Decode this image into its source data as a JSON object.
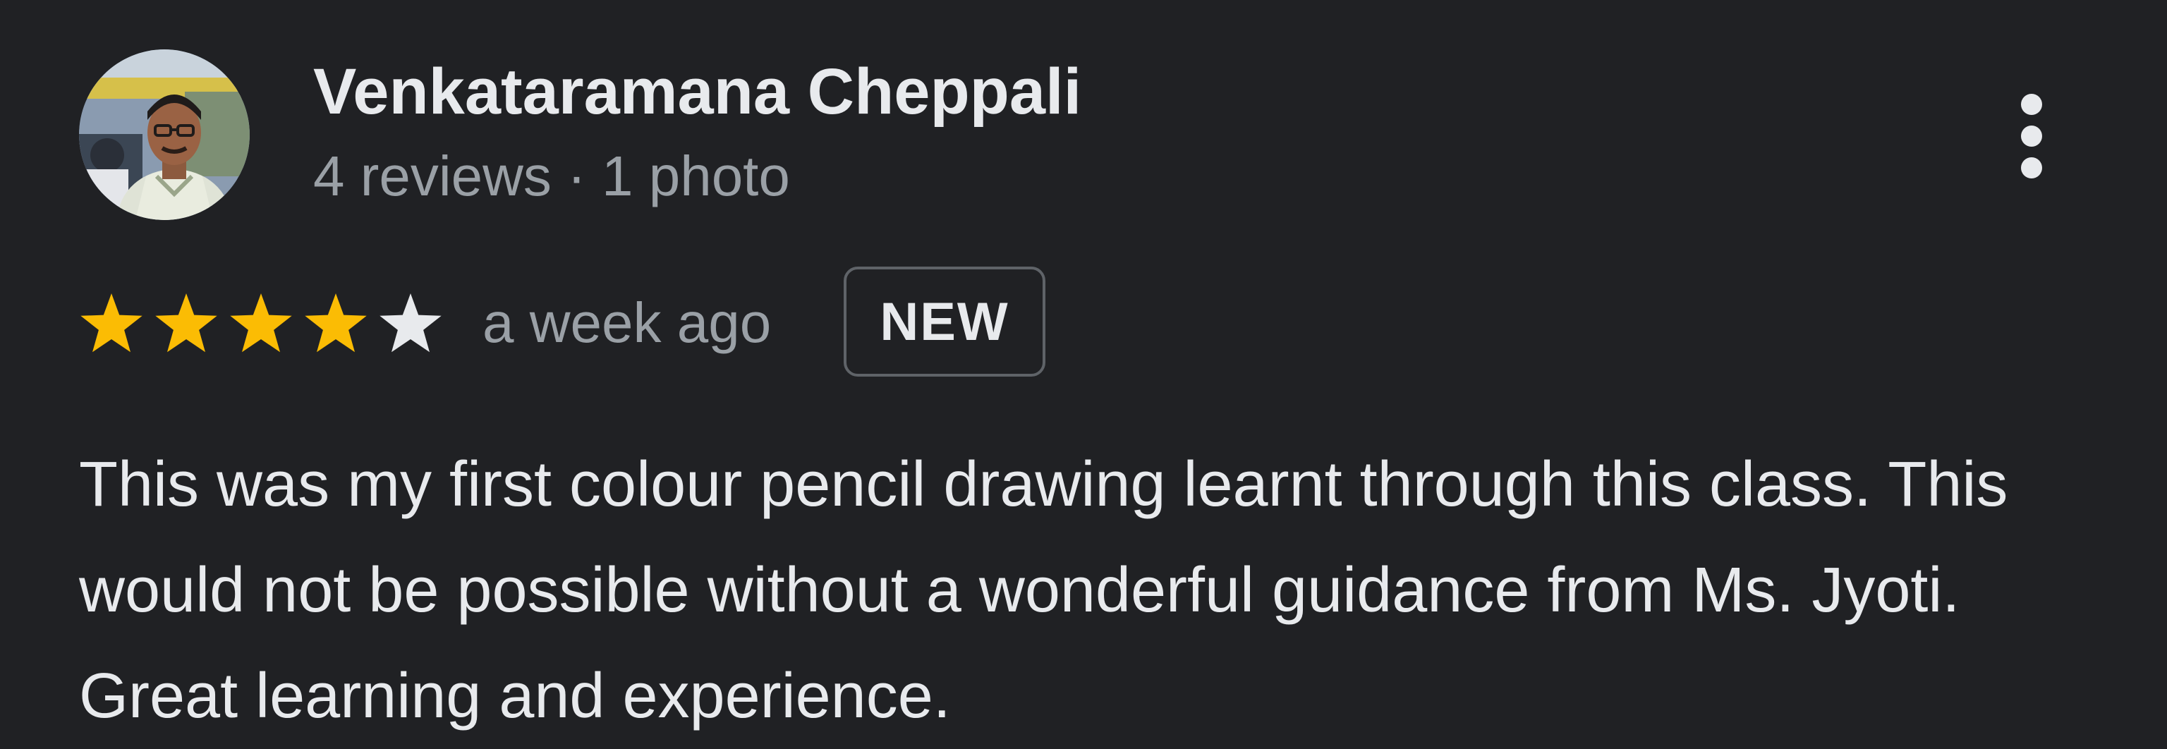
{
  "reviewer": {
    "name": "Venkataramana Cheppali",
    "meta": "4 reviews · 1 photo",
    "avatar_icon": "user-photo"
  },
  "rating": {
    "stars": 4,
    "max_stars": 5,
    "date": "a week ago",
    "badge": "NEW"
  },
  "review": {
    "text": "This was my first colour pencil drawing learnt through this class. This would not be possible without a wonderful guidance from Ms. Jyoti. Great learning and experience."
  },
  "menu": {
    "icon": "more-vert-icon"
  },
  "colors": {
    "background": "#202124",
    "star_filled": "#fbbc04",
    "star_empty": "#e8eaed",
    "text_primary": "#e8eaed",
    "text_secondary": "#9aa0a6",
    "badge_border": "#5f6368"
  }
}
